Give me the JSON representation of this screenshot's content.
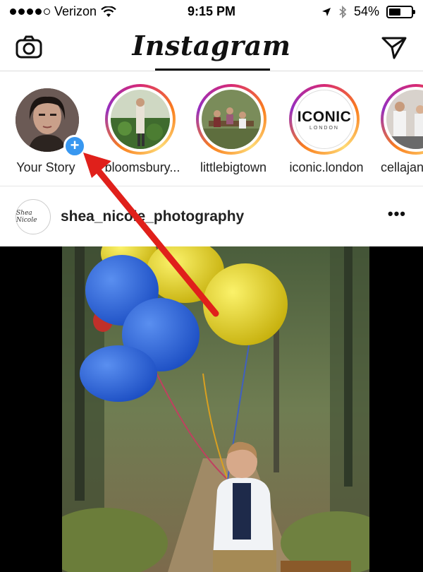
{
  "status_bar": {
    "carrier": "Verizon",
    "time": "9:15 PM",
    "battery": "54%",
    "battery_level": 0.54
  },
  "header": {
    "title": "Instagram",
    "left_icon": "camera-icon",
    "right_icon": "direct-message-icon"
  },
  "stories": [
    {
      "label": "Your Story",
      "type": "own",
      "badge": "+"
    },
    {
      "label": "bloomsbury..."
    },
    {
      "label": "littlebigtown"
    },
    {
      "label": "iconic.london",
      "avatar_text": "ICONIC",
      "avatar_subtext": "LONDON"
    },
    {
      "label": "cellajan"
    }
  ],
  "post": {
    "username": "shea_nicole_photography",
    "avatar_text": "Shea Nicole",
    "more": "•••"
  },
  "colors": {
    "story_ring": "#d62976",
    "add_badge": "#3897f0",
    "annotation_arrow": "#e0201b"
  }
}
